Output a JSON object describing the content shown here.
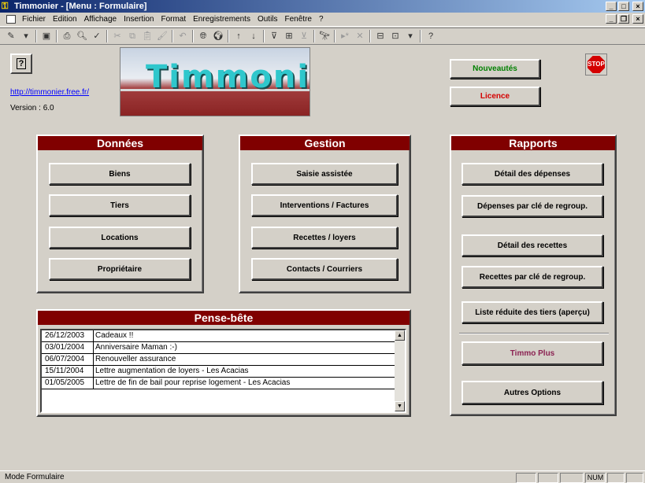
{
  "window": {
    "title": "Timmonier - [Menu : Formulaire]"
  },
  "menubar": {
    "items": [
      "Fichier",
      "Edition",
      "Affichage",
      "Insertion",
      "Format",
      "Enregistrements",
      "Outils",
      "Fenêtre",
      "?"
    ]
  },
  "header": {
    "link": "http://timmonier.free.fr/",
    "version": "Version : 6.0",
    "logo_text": "Timmonier",
    "nouveautes": "Nouveautés",
    "licence": "Licence",
    "stop": "STOP"
  },
  "donnees": {
    "title": "Données",
    "buttons": [
      "Biens",
      "Tiers",
      "Locations",
      "Propriétaire"
    ]
  },
  "gestion": {
    "title": "Gestion",
    "buttons": [
      "Saisie assistée",
      "Interventions / Factures",
      "Recettes / loyers",
      "Contacts / Courriers"
    ]
  },
  "rapports": {
    "title": "Rapports",
    "buttons": [
      "Détail des dépenses",
      "Dépenses par clé de regroup.",
      "Détail des recettes",
      "Recettes par clé de regroup.",
      "Liste réduite des tiers (aperçu)"
    ],
    "timmo_plus": "Timmo Plus",
    "autres": "Autres Options"
  },
  "pense_bete": {
    "title": "Pense-bête",
    "rows": [
      {
        "date": "26/12/2003",
        "text": "Cadeaux !!"
      },
      {
        "date": "03/01/2004",
        "text": "Anniversaire Maman :-)"
      },
      {
        "date": "06/07/2004",
        "text": "Renouveller assurance"
      },
      {
        "date": "15/11/2004",
        "text": "Lettre augmentation de loyers - Les Acacias"
      },
      {
        "date": "01/05/2005",
        "text": "Lettre de fin de bail pour reprise logement - Les Acacias"
      }
    ]
  },
  "statusbar": {
    "text": "Mode Formulaire",
    "num": "NUM"
  },
  "colors": {
    "panel_header": "#800000",
    "nouveautes": "#008000",
    "licence": "#d40000",
    "timmo_plus": "#8b2252"
  }
}
